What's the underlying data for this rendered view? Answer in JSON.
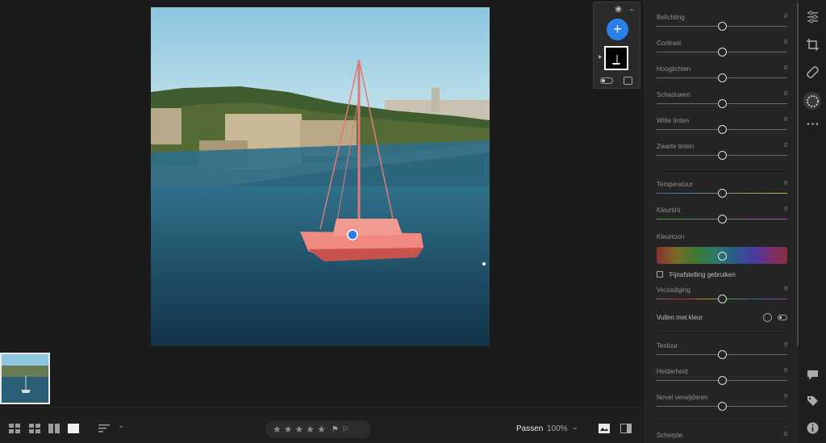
{
  "toolbar": {
    "fit_label": "Passen",
    "zoom_label": "100%",
    "stars": [
      "★",
      "★",
      "★",
      "★",
      "★"
    ],
    "flags": [
      "⚑",
      "⚐"
    ]
  },
  "mask_panel": {
    "add_label": "+"
  },
  "edit_panel": {
    "light": [
      {
        "label": "Belichting",
        "value": "0",
        "level": 0.5
      },
      {
        "label": "Contrast",
        "value": "0",
        "level": 0.5
      },
      {
        "label": "Hooglichten",
        "value": "0",
        "level": 0.5
      },
      {
        "label": "Schaduwen",
        "value": "0",
        "level": 0.5
      },
      {
        "label": "Witte tinten",
        "value": "0",
        "level": 0.5
      },
      {
        "label": "Zwarte tinten",
        "value": "0",
        "level": 0.5
      }
    ],
    "color": [
      {
        "label": "Temperatuur",
        "value": "0",
        "level": 0.5
      },
      {
        "label": "Kleurtint",
        "value": "0",
        "level": 0.5
      }
    ],
    "hue": {
      "label": "Kleurtoon",
      "level": 0.5
    },
    "fine_tune_label": "Fijnafstelling gebruiken",
    "saturation": {
      "label": "Verzadiging",
      "value": "0",
      "level": 0.5
    },
    "fill_label": "Vullen met kleur",
    "effects": [
      {
        "label": "Textuur",
        "value": "0",
        "level": 0.5
      },
      {
        "label": "Helderheid",
        "value": "0",
        "level": 0.5
      },
      {
        "label": "Nevel verwijderen",
        "value": "0",
        "level": 0.5
      }
    ],
    "detail": [
      {
        "label": "Scherpte",
        "value": "0",
        "level": 0.5
      }
    ]
  },
  "icons": {
    "strip": [
      "sliders-icon",
      "crop-icon",
      "healing-icon",
      "masking-icon",
      "more-icon",
      "comment-icon",
      "tag-icon",
      "info-icon"
    ]
  },
  "colors": {
    "accent": "#2b7fe6",
    "mask_overlay": "#ff6a6a"
  }
}
